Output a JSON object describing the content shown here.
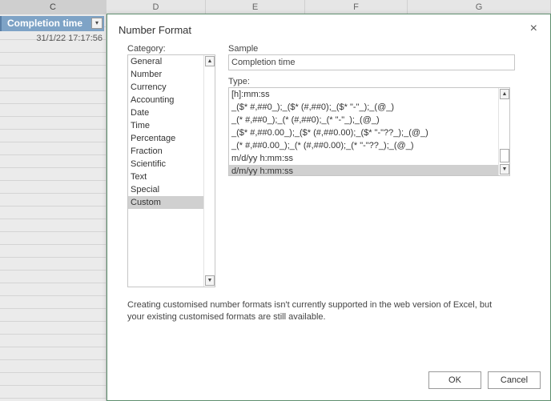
{
  "sheet": {
    "columns": [
      "C",
      "D",
      "E",
      "F",
      "G"
    ],
    "header_cell": "Completion time",
    "filter_glyph": "▾",
    "date_cell": "31/1/22 17:17:56"
  },
  "dialog": {
    "title": "Number Format",
    "close_glyph": "×",
    "category_label": "Category:",
    "categories": [
      {
        "label": "General"
      },
      {
        "label": "Number"
      },
      {
        "label": "Currency"
      },
      {
        "label": "Accounting"
      },
      {
        "label": "Date"
      },
      {
        "label": "Time"
      },
      {
        "label": "Percentage"
      },
      {
        "label": "Fraction"
      },
      {
        "label": "Scientific"
      },
      {
        "label": "Text"
      },
      {
        "label": "Special"
      },
      {
        "label": "Custom"
      }
    ],
    "selected_category": "Custom",
    "sample_label": "Sample",
    "sample_value": "Completion time",
    "type_label": "Type:",
    "types": [
      {
        "label": "[h]:mm:ss"
      },
      {
        "label": "_($* #,##0_);_($* (#,##0);_($* \"-\"_);_(@_)"
      },
      {
        "label": "_(* #,##0_);_(* (#,##0);_(* \"-\"_);_(@_)"
      },
      {
        "label": "_($* #,##0.00_);_($* (#,##0.00);_($* \"-\"??_);_(@_)"
      },
      {
        "label": "_(* #,##0.00_);_(* (#,##0.00);_(* \"-\"??_);_(@_)"
      },
      {
        "label": "m/d/yy h:mm:ss"
      },
      {
        "label": "d/m/yy h:mm:ss"
      }
    ],
    "selected_type": "d/m/yy h:mm:ss",
    "note": "Creating customised number formats isn't currently supported in the web version of Excel, but your existing customised formats are still available.",
    "ok_label": "OK",
    "cancel_label": "Cancel",
    "scroll_up_glyph": "▲",
    "scroll_down_glyph": "▼"
  }
}
